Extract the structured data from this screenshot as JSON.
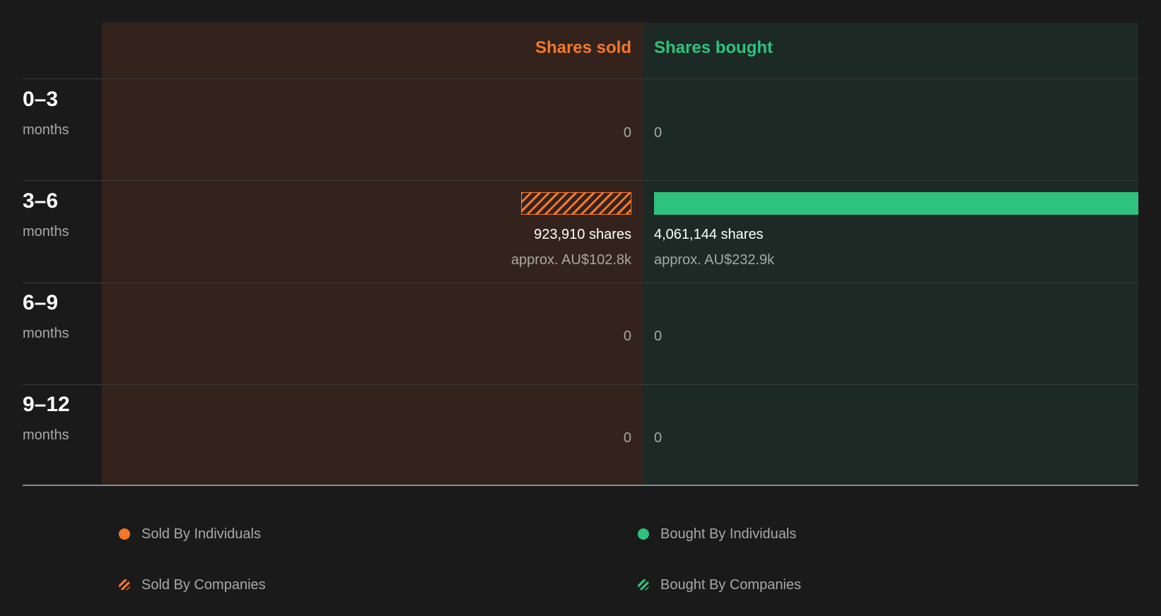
{
  "colors": {
    "sold": "#f5772a",
    "bought": "#2ec27e",
    "sold_bg": "#33231c",
    "bought_bg": "#1c2925"
  },
  "chart_data": {
    "type": "bar",
    "orientation": "horizontal-diverging",
    "headers": {
      "sold": "Shares sold",
      "bought": "Shares bought"
    },
    "unit_label": "months",
    "categories": [
      "0–3",
      "3–6",
      "6–9",
      "9–12"
    ],
    "rows": [
      {
        "range": "0–3",
        "unit": "months",
        "sold": 0,
        "bought": 0,
        "sold_text": "0",
        "bought_text": "0"
      },
      {
        "range": "3–6",
        "unit": "months",
        "sold": 923910,
        "bought": 4061144,
        "sold_text": "923,910 shares",
        "bought_text": "4,061,144 shares",
        "sold_approx": "approx. AU$102.8k",
        "bought_approx": "approx. AU$232.9k",
        "sold_by": "companies",
        "bought_by": "individuals"
      },
      {
        "range": "6–9",
        "unit": "months",
        "sold": 0,
        "bought": 0,
        "sold_text": "0",
        "bought_text": "0"
      },
      {
        "range": "9–12",
        "unit": "months",
        "sold": 0,
        "bought": 0,
        "sold_text": "0",
        "bought_text": "0"
      }
    ],
    "series": [
      {
        "name": "Sold By Individuals",
        "pattern": "solid",
        "color": "#f5772a"
      },
      {
        "name": "Sold By Companies",
        "pattern": "hatched",
        "color": "#f5772a"
      },
      {
        "name": "Bought By Individuals",
        "pattern": "solid",
        "color": "#2ec27e"
      },
      {
        "name": "Bought By Companies",
        "pattern": "hatched",
        "color": "#2ec27e"
      }
    ],
    "scale_max": 4061144,
    "grid": true,
    "legend_position": "bottom"
  },
  "legend": {
    "sold_individuals": "Sold By Individuals",
    "sold_companies": "Sold By Companies",
    "bought_individuals": "Bought By Individuals",
    "bought_companies": "Bought By Companies"
  }
}
